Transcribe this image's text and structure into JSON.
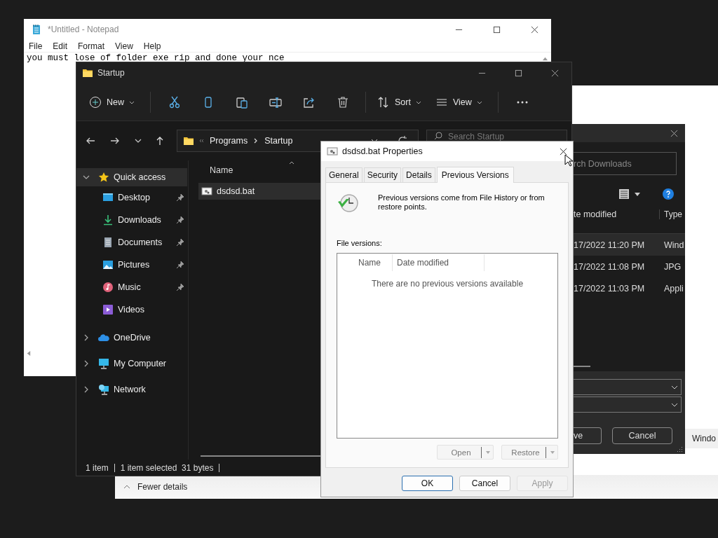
{
  "notepad": {
    "title": "*Untitled - Notepad",
    "menu": [
      "File",
      "Edit",
      "Format",
      "View",
      "Help"
    ],
    "text": "you must lose of folder exe rip and done your nce"
  },
  "back_window": {
    "toggle": "Fewer details",
    "column_text": "Windo"
  },
  "save_dialog": {
    "search_placeholder": "rch Downloads",
    "columns": [
      "te modified",
      "Type"
    ],
    "rows": [
      {
        "date": "17/2022 11:20 PM",
        "type": "Wind",
        "selected": true
      },
      {
        "date": "17/2022 11:08 PM",
        "type": "JPG",
        "selected": false
      },
      {
        "date": "17/2022 11:03 PM",
        "type": "Appli",
        "selected": false
      }
    ],
    "buttons": [
      "ve",
      "Cancel"
    ]
  },
  "explorer": {
    "title": "Startup",
    "toolbar": {
      "new": "New",
      "sort": "Sort",
      "view": "View"
    },
    "breadcrumb": [
      "Programs",
      "Startup"
    ],
    "search_placeholder": "Search Startup",
    "sidebar": {
      "items": [
        {
          "label": "Quick access",
          "kind": "star",
          "expanded": true,
          "selected": true,
          "children": [
            {
              "label": "Desktop",
              "kind": "desktop",
              "pinned": true,
              "selected": false
            },
            {
              "label": "Downloads",
              "kind": "download",
              "pinned": true,
              "selected": false
            },
            {
              "label": "Documents",
              "kind": "document",
              "pinned": true,
              "selected": false
            },
            {
              "label": "Pictures",
              "kind": "picture",
              "pinned": true,
              "selected": false
            },
            {
              "label": "Music",
              "kind": "music",
              "pinned": true,
              "selected": false
            },
            {
              "label": "Videos",
              "kind": "video",
              "pinned": false,
              "selected": false
            }
          ]
        },
        {
          "label": "OneDrive",
          "kind": "cloud",
          "expanded": false,
          "selected": false
        },
        {
          "label": "My Computer",
          "kind": "computer",
          "expanded": false,
          "selected": false
        },
        {
          "label": "Network",
          "kind": "network",
          "expanded": false,
          "selected": false
        }
      ]
    },
    "column": "Name",
    "files": [
      {
        "name": "dsdsd.bat",
        "selected": true
      }
    ],
    "status": [
      "1 item",
      "1 item selected  31 bytes"
    ]
  },
  "properties": {
    "title": "dsdsd.bat Properties",
    "tabs": [
      {
        "label": "General",
        "selected": false
      },
      {
        "label": "Security",
        "selected": false
      },
      {
        "label": "Details",
        "selected": false
      },
      {
        "label": "Previous Versions",
        "selected": true
      }
    ],
    "info": "Previous versions come from File History or from restore points.",
    "list_label": "File versions:",
    "columns": [
      "Name",
      "Date modified"
    ],
    "empty": "There are no previous versions available",
    "actions": [
      {
        "label": "Open",
        "disabled": true
      },
      {
        "label": "Restore",
        "disabled": true
      }
    ],
    "buttons": [
      {
        "label": "OK",
        "default": true,
        "disabled": false
      },
      {
        "label": "Cancel",
        "default": false,
        "disabled": false
      },
      {
        "label": "Apply",
        "default": false,
        "disabled": true
      }
    ]
  }
}
